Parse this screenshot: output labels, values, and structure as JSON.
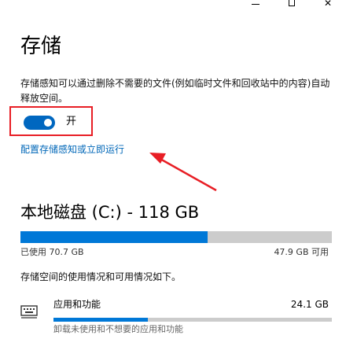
{
  "window": {
    "minimize_icon": "minimize-icon",
    "maximize_icon": "maximize-icon",
    "close_glyph": "✕"
  },
  "storage": {
    "title": "存储",
    "description": "存储感知可以通过删除不需要的文件(例如临时文件和回收站中的内容)自动释放空间。",
    "toggle": {
      "state": "开",
      "on": true
    },
    "config_link": "配置存储感知或立即运行"
  },
  "drive": {
    "title": "本地磁盘 (C:) - 118 GB",
    "used_label": "已使用 70.7 GB",
    "free_label": "47.9 GB 可用",
    "used_fraction": 0.6
  },
  "usage": {
    "description": "存储空间的使用情况和可用情况如下。",
    "categories": [
      {
        "icon": "keyboard-icon",
        "name": "应用和功能",
        "size": "24.1 GB",
        "description": "卸载未使用和不想要的应用和功能",
        "fraction": 0.34
      }
    ]
  },
  "colors": {
    "accent": "#0078d7",
    "toggle_on": "#0067c0",
    "link": "#0067b8",
    "highlight_box": "#e81e25",
    "annotation_arrow": "#e81e25"
  }
}
